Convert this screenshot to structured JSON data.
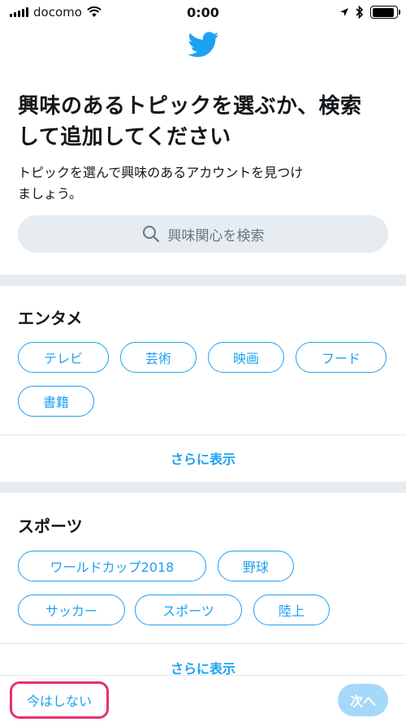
{
  "status_bar": {
    "carrier": "docomo",
    "time": "0:00",
    "battery_level": 0.9
  },
  "header": {
    "logo_icon": "twitter-bird-icon",
    "title_line1": "興味のあるトピックを選ぶか、検索",
    "title_line2": "して追加してください",
    "subtitle_line1": "トピックを選んで興味のあるアカウントを見つけ",
    "subtitle_line2": "ましょう。"
  },
  "search": {
    "icon": "search-icon",
    "placeholder": "興味関心を検索"
  },
  "sections": [
    {
      "title": "エンタメ",
      "topics": [
        "テレビ",
        "芸術",
        "映画",
        "フード",
        "書籍"
      ],
      "more_label": "さらに表示"
    },
    {
      "title": "スポーツ",
      "topics": [
        "ワールドカップ2018",
        "野球",
        "サッカー",
        "スポーツ",
        "陸上"
      ],
      "more_label": "さらに表示"
    }
  ],
  "footer": {
    "skip_label": "今はしない",
    "next_label": "次へ"
  },
  "colors": {
    "accent": "#1da1f2",
    "highlight": "#e8306f",
    "divider": "#e6ecf0",
    "next_disabled": "#a5d8f9"
  }
}
